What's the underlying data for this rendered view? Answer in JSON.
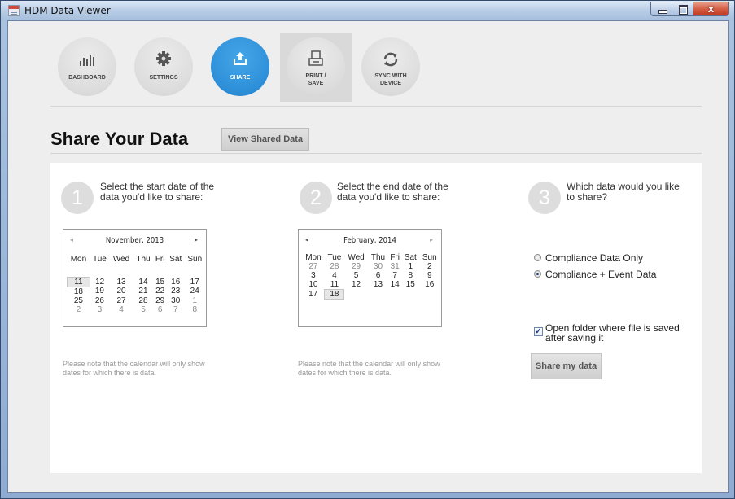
{
  "window": {
    "title": "HDM Data Viewer"
  },
  "nav": {
    "items": [
      {
        "label": "DASHBOARD",
        "icon": "bar-chart-icon"
      },
      {
        "label": "SETTINGS",
        "icon": "gear-icon"
      },
      {
        "label": "SHARE",
        "icon": "upload-share-icon",
        "active": true
      },
      {
        "label_line1": "PRINT /",
        "label_line2": "SAVE",
        "icon": "printer-icon"
      },
      {
        "label_line1": "SYNC WITH",
        "label_line2": "DEVICE",
        "icon": "sync-icon"
      }
    ]
  },
  "page": {
    "title": "Share Your Data",
    "view_shared_label": "View Shared Data"
  },
  "step1": {
    "number": "1",
    "text_line1": "Select the start date of the",
    "text_line2": "data you'd like to share:",
    "calendar": {
      "month": "November, 2013",
      "weekdays": [
        "Mon",
        "Tue",
        "Wed",
        "Thu",
        "Fri",
        "Sat",
        "Sun"
      ],
      "weeks": [
        [
          "11",
          "12",
          "13",
          "14",
          "15",
          "16",
          "17"
        ],
        [
          "18",
          "19",
          "20",
          "21",
          "22",
          "23",
          "24"
        ],
        [
          "25",
          "26",
          "27",
          "28",
          "29",
          "30",
          "1"
        ],
        [
          "2",
          "3",
          "4",
          "5",
          "6",
          "7",
          "8"
        ]
      ],
      "selected": "11"
    },
    "note_line1": "Please note that the calendar will only show",
    "note_line2": "dates for which there is data."
  },
  "step2": {
    "number": "2",
    "text_line1": "Select the end date of the",
    "text_line2": "data you'd like to share:",
    "calendar": {
      "month": "February, 2014",
      "weekdays": [
        "Mon",
        "Tue",
        "Wed",
        "Thu",
        "Fri",
        "Sat",
        "Sun"
      ],
      "weeks": [
        [
          "27",
          "28",
          "29",
          "30",
          "31",
          "1",
          "2"
        ],
        [
          "3",
          "4",
          "5",
          "6",
          "7",
          "8",
          "9"
        ],
        [
          "10",
          "11",
          "12",
          "13",
          "14",
          "15",
          "16"
        ],
        [
          "17",
          "18",
          "",
          "",
          "",
          "",
          ""
        ]
      ],
      "selected": "18"
    },
    "note_line1": "Please note that the calendar will only show",
    "note_line2": "dates for which there is data."
  },
  "step3": {
    "number": "3",
    "text_line1": "Which data would you like",
    "text_line2": "to share?",
    "options": [
      {
        "label": "Compliance Data Only",
        "selected": false
      },
      {
        "label": "Compliance + Event Data",
        "selected": true
      }
    ],
    "open_folder_line1": "Open folder where file is saved",
    "open_folder_line2": "after saving it",
    "open_folder_checked": true,
    "share_button_label": "Share my data"
  },
  "colors": {
    "share_active": "#2d8fd8",
    "panel": "#ffffff",
    "background": "#eeeeee"
  }
}
